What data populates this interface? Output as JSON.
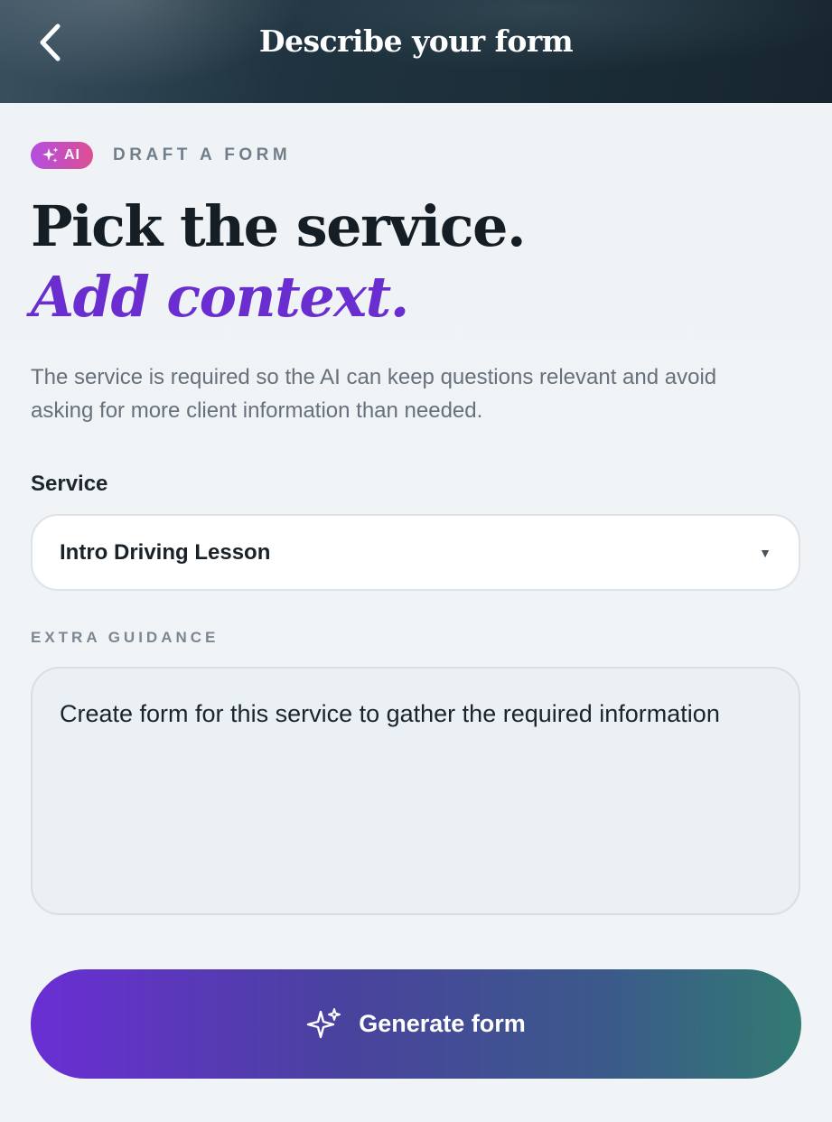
{
  "header": {
    "title": "Describe your form",
    "back_icon": "chevron-left-icon"
  },
  "eyebrow": {
    "badge": "AI",
    "badge_icon": "sparkles-icon",
    "label": "DRAFT A FORM"
  },
  "headline": {
    "line1": "Pick the service.",
    "line2": "Add context."
  },
  "description": "The service is required so the AI can keep questions relevant and avoid asking for more client information than needed.",
  "service": {
    "label": "Service",
    "selected": "Intro Driving Lesson",
    "caret_icon": "caret-down-icon"
  },
  "guidance": {
    "label": "EXTRA GUIDANCE",
    "value": "Create form for this service to gather the required information"
  },
  "generate": {
    "label": "Generate form",
    "icon": "sparkles-icon"
  },
  "colors": {
    "accent_purple": "#6a2ed0",
    "badge_gradient_start": "#b34ee0",
    "badge_gradient_end": "#dd4f93",
    "button_gradient_start": "#6a2ed4",
    "button_gradient_end": "#327a72",
    "header_dark": "#17252e"
  }
}
